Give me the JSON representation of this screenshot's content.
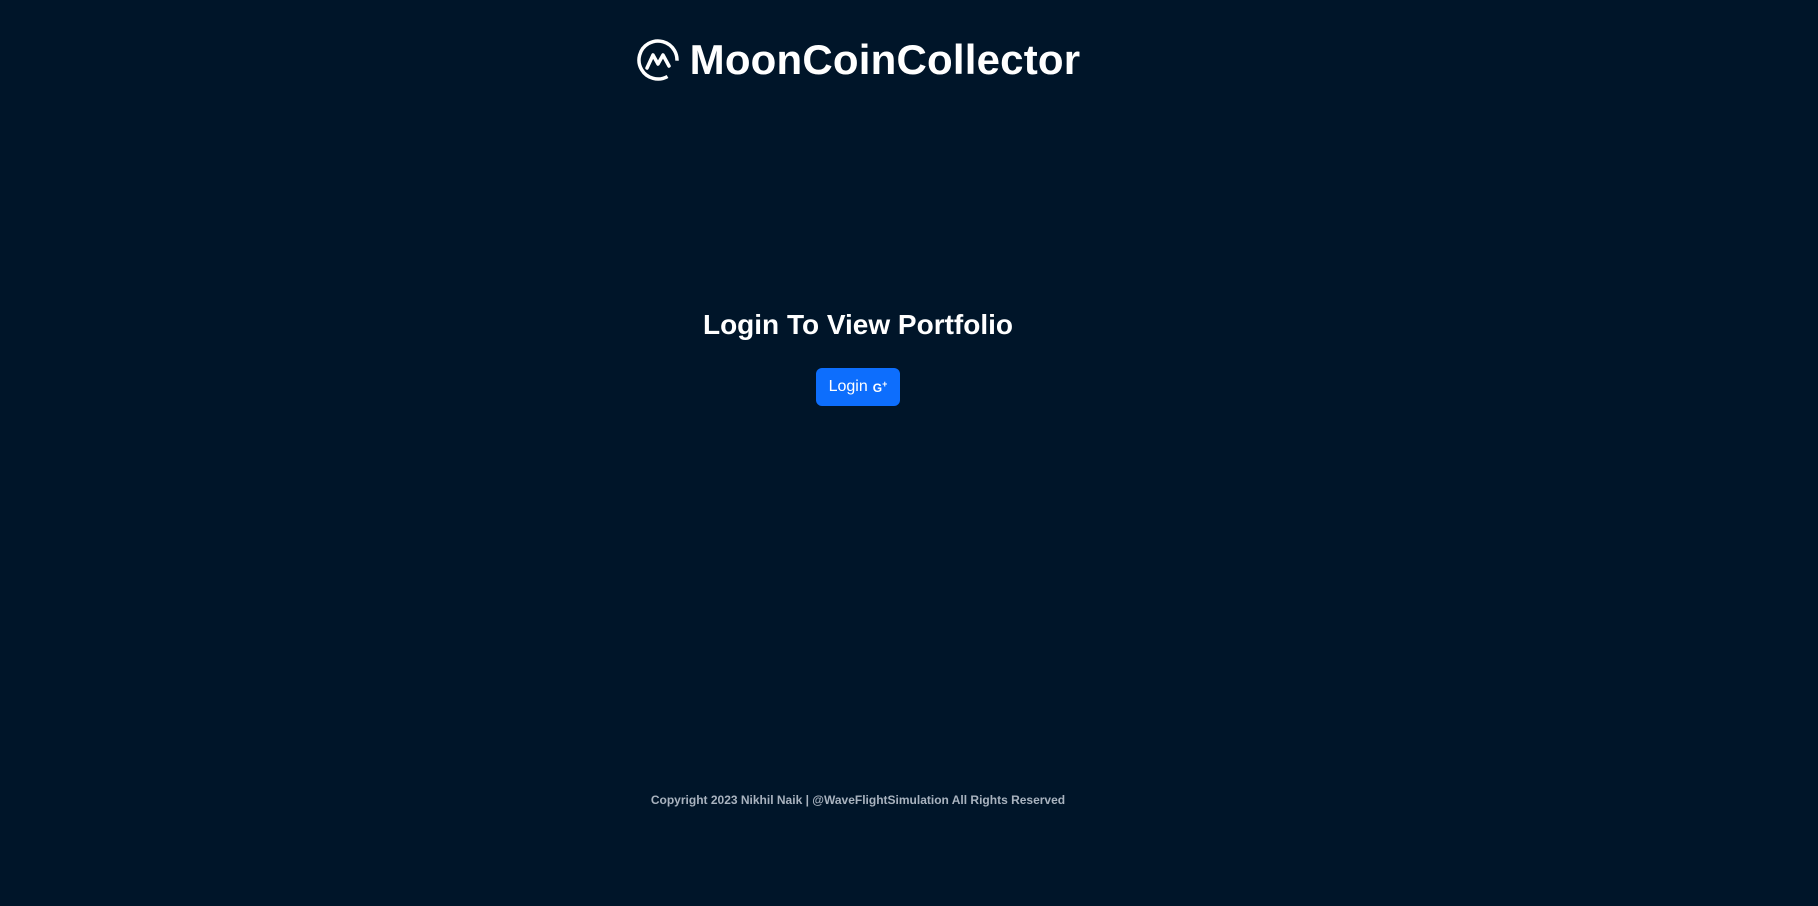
{
  "header": {
    "logo_icon": "coinmarketcap-style-m-icon",
    "title": "MoonCoinCollector"
  },
  "main": {
    "heading": "Login To View Portfolio",
    "login_button": {
      "label": "Login",
      "icon": "google-plus-icon"
    }
  },
  "footer": {
    "text": "Copyright 2023 Nikhil Naik | @WaveFlightSimulation All Rights Reserved"
  },
  "colors": {
    "background": "#001529",
    "button_primary": "#0d6efd",
    "footer_text": "#a9b3bf"
  }
}
